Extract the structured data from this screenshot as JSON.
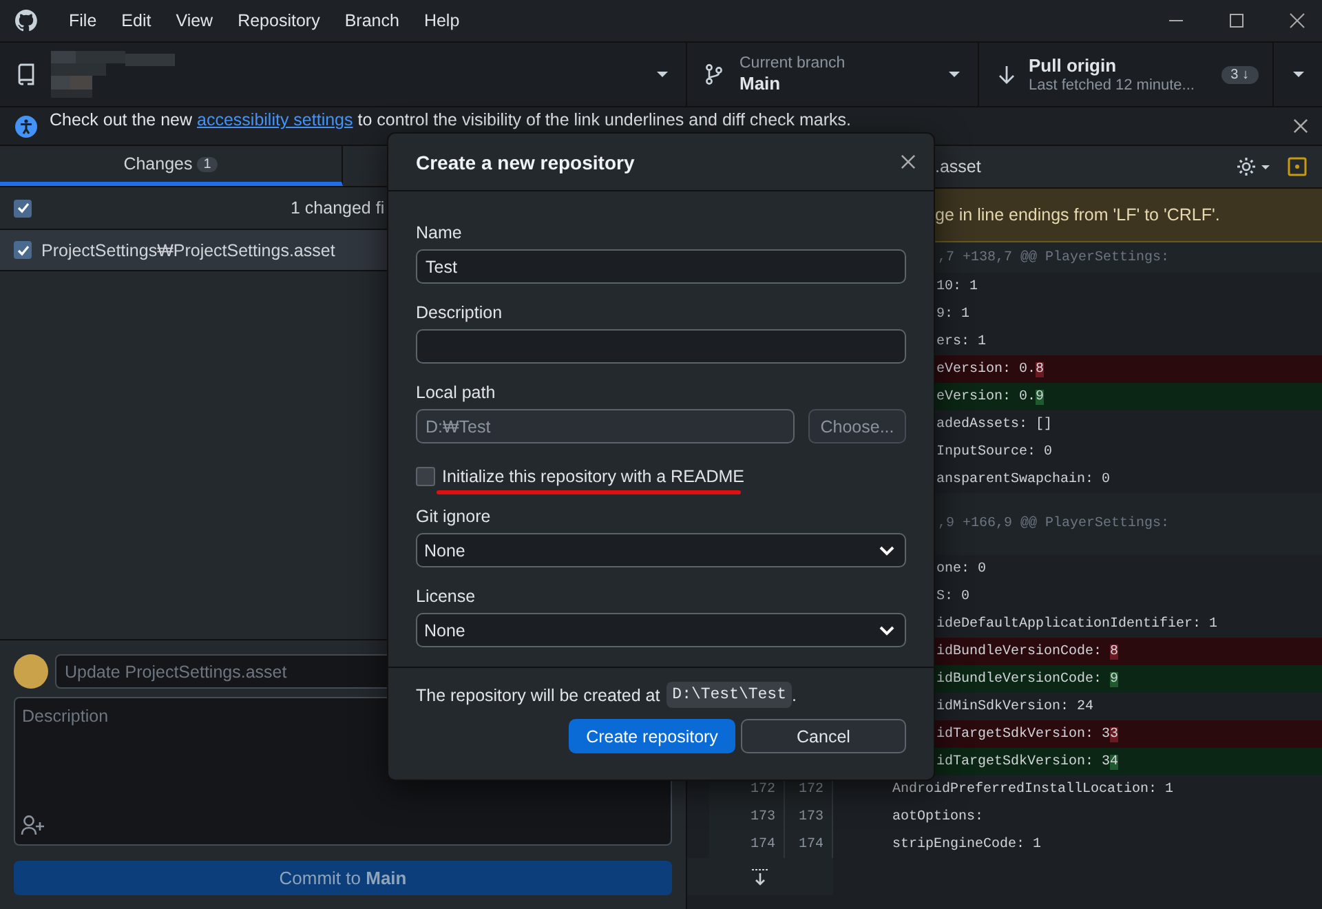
{
  "menu_bar": {
    "items": [
      "File",
      "Edit",
      "View",
      "Repository",
      "Branch",
      "Help"
    ]
  },
  "toolbar": {
    "current_branch": {
      "label": "Current branch",
      "value": "Main"
    },
    "pull": {
      "label": "Pull origin",
      "detail": "Last fetched 12 minute...",
      "badge": "3 ↓"
    }
  },
  "banner": {
    "before": "Check out the new ",
    "link": "accessibility settings",
    "after": " to control the visibility of the link underlines and diff check marks."
  },
  "tabs": [
    {
      "label": "Changes",
      "count": "1",
      "selected": true
    }
  ],
  "changes": {
    "all_checked": true,
    "summary": "1 changed fi",
    "files": [
      {
        "path": "ProjectSettings₩ProjectSettings.asset",
        "checked": true,
        "selected": true
      }
    ]
  },
  "commit": {
    "summary_placeholder": "Update ProjectSettings.asset",
    "description_placeholder": "Description",
    "button": "Commit to **Main**"
  },
  "diff": {
    "file": ".asset",
    "warning": "ge in line endings from 'LF' to 'CRLF'.",
    "lines": [
      {
        "kind": "hunk",
        "text": ",7 +138,7 @@ PlayerSettings:"
      },
      {
        "kind": "context",
        "text": "10: 1"
      },
      {
        "kind": "context",
        "text": "9: 1"
      },
      {
        "kind": "context",
        "text": "ers: 1"
      },
      {
        "kind": "del",
        "text": "eVersion: 0.",
        "changed": "8"
      },
      {
        "kind": "add",
        "text": "eVersion: 0.",
        "changed": "9"
      },
      {
        "kind": "context",
        "text": "adedAssets: []"
      },
      {
        "kind": "context",
        "text": "InputSource: 0"
      },
      {
        "kind": "context",
        "text": "ansparentSwapchain: 0"
      },
      {
        "kind": "hunk",
        "text": ",9 +166,9 @@ PlayerSettings:"
      },
      {
        "kind": "context",
        "text": "one: 0"
      },
      {
        "kind": "context",
        "text": "S: 0"
      },
      {
        "kind": "context",
        "text": "ideDefaultApplicationIdentifier: 1"
      },
      {
        "kind": "del",
        "text": "idBundleVersionCode: ",
        "changed": "8"
      },
      {
        "kind": "add",
        "text": "idBundleVersionCode: ",
        "changed": "9"
      },
      {
        "kind": "context",
        "text": "idMinSdkVersion: 24"
      },
      {
        "kind": "del",
        "text": "idTargetSdkVersion: 3",
        "changed": "3"
      },
      {
        "kind": "add",
        "text": "idTargetSdkVersion: 3",
        "changed": "4"
      },
      {
        "kind": "context",
        "old": "172",
        "new": "172",
        "text": "AndroidPreferredInstallLocation: 1"
      },
      {
        "kind": "context",
        "old": "173",
        "new": "173",
        "text": "aotOptions:"
      },
      {
        "kind": "context",
        "old": "174",
        "new": "174",
        "text": "stripEngineCode: 1"
      }
    ]
  },
  "dialog": {
    "title": "Create a new repository",
    "name": {
      "label": "Name",
      "value": "Test"
    },
    "description": {
      "label": "Description"
    },
    "local_path": {
      "label": "Local path",
      "value": "D:₩Test",
      "disabled": true,
      "button": "Choose..."
    },
    "readme": {
      "label": "Initialize this repository with a README",
      "checked": false,
      "underlined": true
    },
    "gitignore": {
      "label": "Git ignore",
      "value": "None"
    },
    "license": {
      "label": "License",
      "value": "None"
    },
    "footer": {
      "text": "The repository will be created at",
      "path": "D:\\Test\\Test",
      "end": "."
    },
    "buttons": [
      {
        "label": "Create repository",
        "kind": "primary"
      },
      {
        "label": "Cancel",
        "kind": "secondary"
      }
    ]
  }
}
